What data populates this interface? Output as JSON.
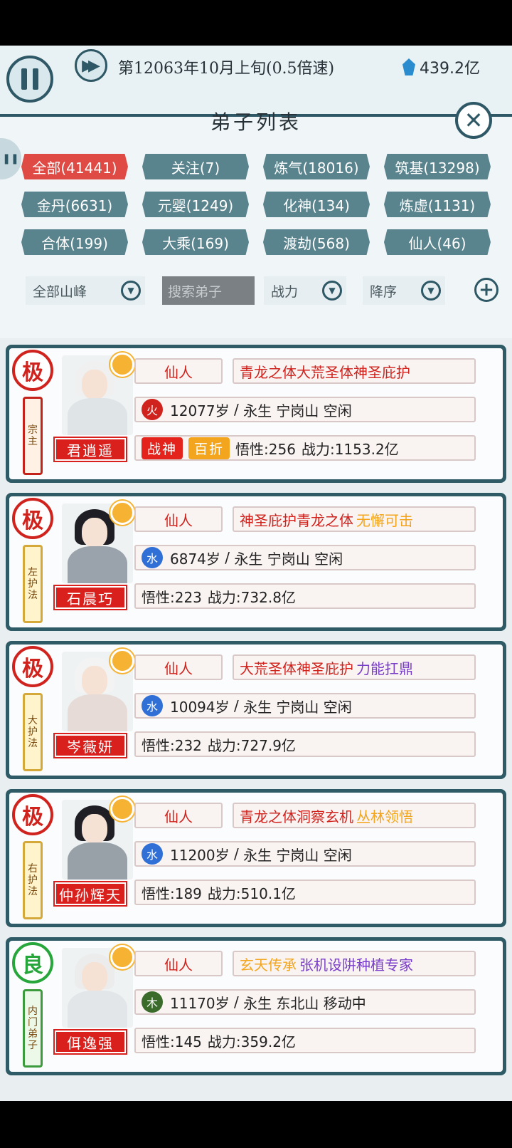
{
  "header": {
    "date_text": "第12063年10月上旬(0.5倍速)",
    "currency": "439.2亿"
  },
  "panel": {
    "title": "弟子列表",
    "filters": [
      {
        "label": "全部(41441)",
        "active": true
      },
      {
        "label": "关注(7)",
        "active": false
      },
      {
        "label": "炼气(18016)",
        "active": false
      },
      {
        "label": "筑基(13298)",
        "active": false
      },
      {
        "label": "金丹(6631)",
        "active": false
      },
      {
        "label": "元婴(1249)",
        "active": false
      },
      {
        "label": "化神(134)",
        "active": false
      },
      {
        "label": "炼虚(1131)",
        "active": false
      },
      {
        "label": "合体(199)",
        "active": false
      },
      {
        "label": "大乘(169)",
        "active": false
      },
      {
        "label": "渡劫(568)",
        "active": false
      },
      {
        "label": "仙人(46)",
        "active": false
      }
    ],
    "mountain_select": "全部山峰",
    "search_placeholder": "搜索弟子",
    "sort_by": "战力",
    "sort_order": "降序"
  },
  "disciples": [
    {
      "grade": "极",
      "rank": "宗主",
      "name": "君逍遥",
      "realm": "仙人",
      "traits": [
        {
          "text": "青龙之体大荒圣体神圣庇护",
          "color": "#d0231d"
        }
      ],
      "element": "火",
      "element_color": "#d0231d",
      "age": "12077岁",
      "status": "永生 宁岗山 空闲",
      "badges": [
        {
          "text": "战神",
          "color": "#e3231c"
        },
        {
          "text": "百折",
          "color": "#f2a51d"
        }
      ],
      "comprehension": "悟性:256",
      "power": "战力:1153.2亿"
    },
    {
      "grade": "极",
      "rank": "左护法",
      "name": "石晨巧",
      "realm": "仙人",
      "traits": [
        {
          "text": "神圣庇护青龙之体",
          "color": "#d0231d"
        },
        {
          "text": "无懈可击",
          "color": "#f2a51d"
        }
      ],
      "element": "水",
      "element_color": "#2f6fd6",
      "age": "6874岁",
      "status": "永生 宁岗山 空闲",
      "badges": [],
      "comprehension": "悟性:223",
      "power": "战力:732.8亿"
    },
    {
      "grade": "极",
      "rank": "大护法",
      "name": "岑薇妍",
      "realm": "仙人",
      "traits": [
        {
          "text": "大荒圣体神圣庇护",
          "color": "#d0231d"
        },
        {
          "text": "力能扛鼎",
          "color": "#7a3fc8"
        }
      ],
      "element": "水",
      "element_color": "#2f6fd6",
      "age": "10094岁",
      "status": "永生 宁岗山 空闲",
      "badges": [],
      "comprehension": "悟性:232",
      "power": "战力:727.9亿"
    },
    {
      "grade": "极",
      "rank": "右护法",
      "name": "仲孙辉天",
      "realm": "仙人",
      "traits": [
        {
          "text": "青龙之体洞察玄机",
          "color": "#d0231d"
        },
        {
          "text": "丛林领悟",
          "color": "#f2a51d"
        }
      ],
      "element": "水",
      "element_color": "#2f6fd6",
      "age": "11200岁",
      "status": "永生 宁岗山 空闲",
      "badges": [],
      "comprehension": "悟性:189",
      "power": "战力:510.1亿"
    },
    {
      "grade": "良",
      "rank": "内门弟子",
      "name": "佴逸强",
      "realm": "仙人",
      "traits": [
        {
          "text": "玄天传承",
          "color": "#f2a51d"
        },
        {
          "text": "张机设阱种植专家",
          "color": "#7a3fc8"
        }
      ],
      "element": "木",
      "element_color": "#3a6b2a",
      "age": "11170岁",
      "status": "永生 东北山 移动中",
      "badges": [],
      "comprehension": "悟性:145",
      "power": "战力:359.2亿"
    }
  ],
  "icons": [
    "pause-icon",
    "fast-forward-icon",
    "gem-icon",
    "close-icon",
    "chevron-down-icon",
    "plus-icon",
    "sun-icon"
  ]
}
